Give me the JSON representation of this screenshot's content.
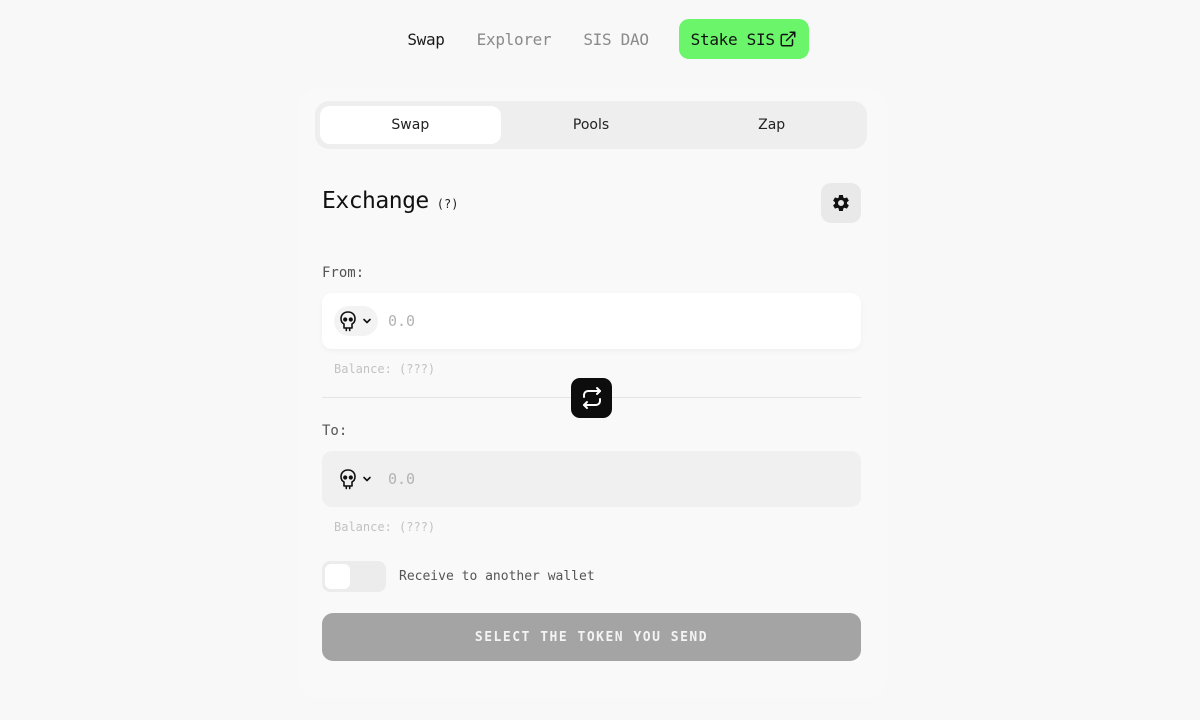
{
  "nav": {
    "links": [
      {
        "label": "Swap"
      },
      {
        "label": "Explorer"
      },
      {
        "label": "SIS DAO"
      }
    ],
    "stake_label": "Stake SIS",
    "stake_color": "#6bf56b"
  },
  "tabs": [
    {
      "label": "Swap"
    },
    {
      "label": "Pools"
    },
    {
      "label": "Zap"
    }
  ],
  "exchange": {
    "title": "Exchange",
    "help": "(?)"
  },
  "from": {
    "label": "From:",
    "token_icon": "skull-icon",
    "amount_placeholder": "0.0",
    "balance": "Balance: (???)"
  },
  "to": {
    "label": "To:",
    "token_icon": "skull-icon",
    "amount_placeholder": "0.0",
    "balance": "Balance: (???)"
  },
  "toggle": {
    "label": "Receive to another wallet",
    "on": false
  },
  "cta_label": "SELECT THE TOKEN YOU SEND"
}
